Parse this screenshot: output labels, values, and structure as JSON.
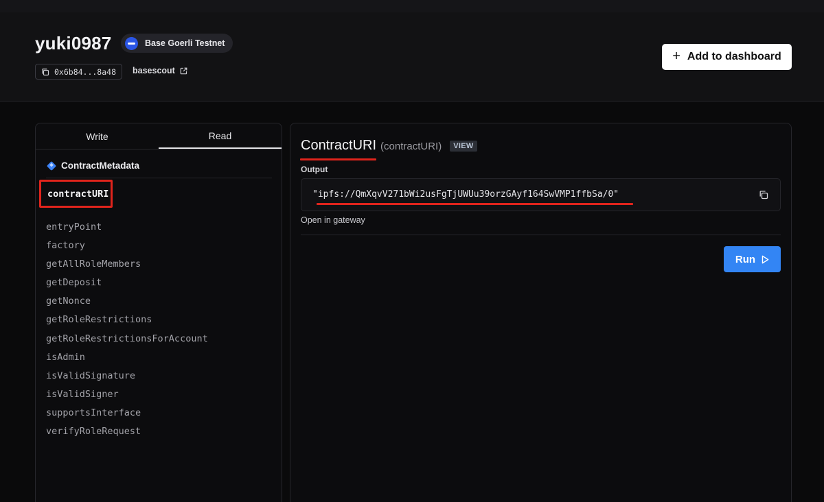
{
  "header": {
    "title": "yuki0987",
    "network": "Base Goerli Testnet",
    "address": "0x6b84...8a48",
    "explorer_link": "basescout",
    "add_button": "Add to dashboard"
  },
  "tabs": [
    {
      "label": "Write",
      "active": false
    },
    {
      "label": "Read",
      "active": true
    }
  ],
  "sidebar": {
    "section": "ContractMetadata",
    "selected": "contractURI",
    "functions": [
      "entryPoint",
      "factory",
      "getAllRoleMembers",
      "getDeposit",
      "getNonce",
      "getRoleRestrictions",
      "getRoleRestrictionsForAccount",
      "isAdmin",
      "isValidSignature",
      "isValidSigner",
      "supportsInterface",
      "verifyRoleRequest"
    ]
  },
  "detail": {
    "function_name": "ContractURI",
    "function_sub": "(contractURI)",
    "badge": "VIEW",
    "output_label": "Output",
    "output_value": "\"ipfs://QmXqvV271bWi2usFgTjUWUu39orzGAyf164SwVMP1ffbSa/0\"",
    "gateway_link": "Open in gateway",
    "run_button": "Run"
  },
  "colors": {
    "accent": "#3385f4",
    "highlight": "#e0241c",
    "network_icon": "#2a55e5"
  }
}
